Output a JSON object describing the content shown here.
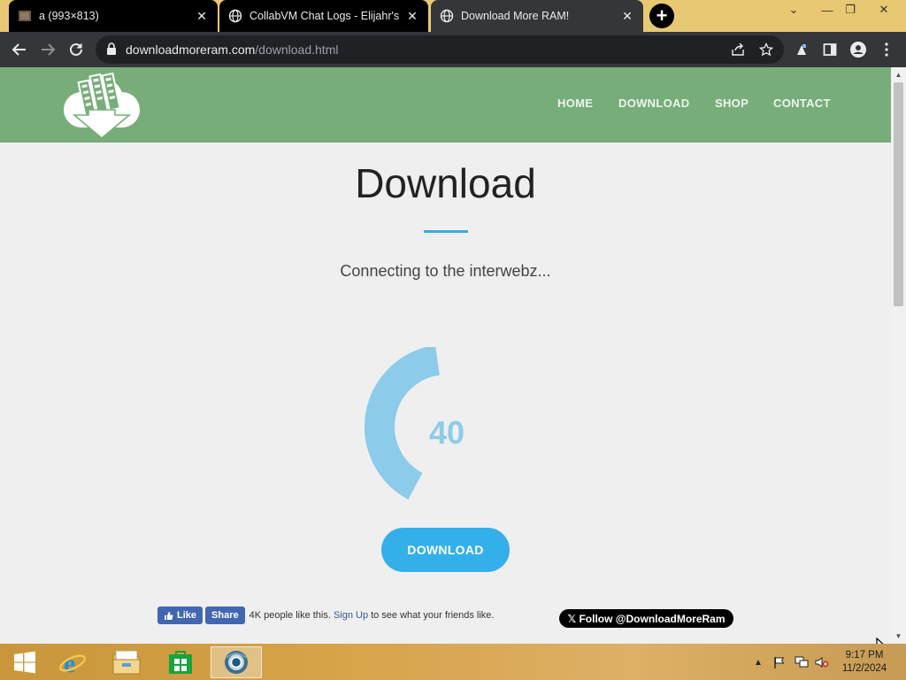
{
  "browser": {
    "tabs": [
      {
        "title": "a (993×813)",
        "close": "✕"
      },
      {
        "title": "CollabVM Chat Logs - Elijahr's W",
        "close": "✕"
      },
      {
        "title": "Download More RAM!",
        "close": "✕"
      }
    ],
    "new_tab": "+",
    "window_controls": {
      "down": "⌄",
      "minimize": "—",
      "restore": "❐",
      "close": "✕"
    },
    "url": {
      "host": "downloadmoreram.com",
      "path": "/download.html"
    }
  },
  "site": {
    "nav": [
      "HOME",
      "DOWNLOAD",
      "SHOP",
      "CONTACT"
    ],
    "page_title": "Download",
    "status": "Connecting to the interwebz...",
    "progress": {
      "value": "40",
      "max": 100,
      "arc_fraction": 0.4
    },
    "download_button": "DOWNLOAD",
    "accent_color": "#33b0ea",
    "header_color": "#77ad79"
  },
  "social": {
    "fb_like": "Like",
    "fb_share": "Share",
    "fb_count": "4K people like this.",
    "fb_signup": "Sign Up",
    "fb_suffix": "to see what your friends like.",
    "twitter_follow": "𝕏 Follow @DownloadMoreRam"
  },
  "taskbar": {
    "apps": [
      "start-icon",
      "internet-explorer-icon",
      "file-explorer-icon",
      "store-icon",
      "chrome-icon"
    ],
    "clock_time": "9:17 PM",
    "clock_date": "11/2/2024"
  }
}
